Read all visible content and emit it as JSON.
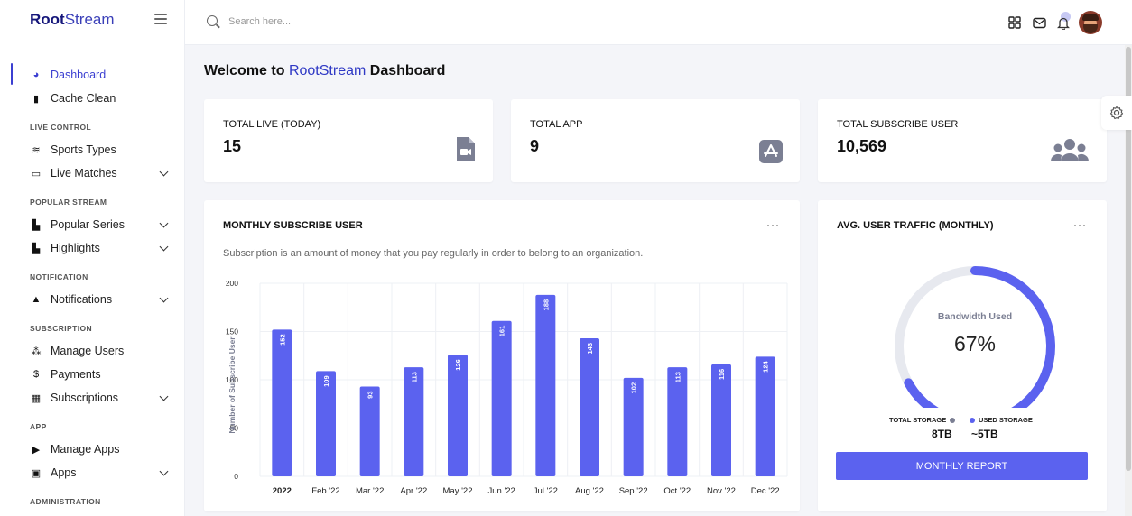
{
  "brand": {
    "strong": "Root",
    "light": "Stream"
  },
  "search": {
    "placeholder": "Search here..."
  },
  "sidebar": {
    "items": [
      {
        "label": "Dashboard",
        "icon": "dashboard-icon",
        "active": true
      },
      {
        "label": "Cache Clean",
        "icon": "trash-icon"
      },
      {
        "section": "LIVE CONTROL"
      },
      {
        "label": "Sports Types",
        "icon": "layers-icon"
      },
      {
        "label": "Live Matches",
        "icon": "monitor-icon",
        "chevron": true
      },
      {
        "section": "POPULAR STREAM"
      },
      {
        "label": "Popular Series",
        "icon": "file-icon",
        "chevron": true
      },
      {
        "label": "Highlights",
        "icon": "file-icon",
        "chevron": true
      },
      {
        "section": "NOTIFICATION"
      },
      {
        "label": "Notifications",
        "icon": "bell-icon",
        "chevron": true
      },
      {
        "section": "SUBSCRIPTION"
      },
      {
        "label": "Manage Users",
        "icon": "users-icon"
      },
      {
        "label": "Payments",
        "icon": "dollar-icon"
      },
      {
        "label": "Subscriptions",
        "icon": "grid-icon",
        "chevron": true
      },
      {
        "section": "APP"
      },
      {
        "label": "Manage Apps",
        "icon": "play-icon"
      },
      {
        "label": "Apps",
        "icon": "image-icon",
        "chevron": true
      },
      {
        "section": "ADMINISTRATION"
      }
    ]
  },
  "welcome": {
    "prefix": "Welcome to ",
    "brand": "RootStream",
    "suffix": " Dashboard"
  },
  "stats": [
    {
      "label": "TOTAL LIVE (TODAY)",
      "value": "15",
      "icon": "video-file-icon"
    },
    {
      "label": "TOTAL APP",
      "value": "9",
      "icon": "app-store-icon"
    },
    {
      "label": "TOTAL SUBSCRIBE USER",
      "value": "10,569",
      "icon": "users-group-icon"
    }
  ],
  "monthly": {
    "title": "MONTHLY SUBSCRIBE USER",
    "dots": "···",
    "description": "Subscription is an amount of money that you pay regularly in order to belong to an organization."
  },
  "traffic": {
    "title": "AVG. USER TRAFFIC (MONTHLY)",
    "dots": "···",
    "gauge_label": "Bandwidth Used",
    "gauge_text": "67%",
    "gauge_value": 0.67,
    "legend": [
      {
        "label": "TOTAL STORAGE",
        "value": "8TB",
        "color": "#7b7f93"
      },
      {
        "label": "USED STORAGE",
        "value": "~5TB",
        "color": "#5b62ef"
      }
    ],
    "button": "MONTHLY REPORT"
  },
  "colors": {
    "accent": "#5b62ef",
    "brand": "#2f39c5",
    "track": "#e7e9ef"
  },
  "chart_data": {
    "type": "bar",
    "categories": [
      "2022",
      "Feb '22",
      "Mar '22",
      "Apr '22",
      "May '22",
      "Jun '22",
      "Jul '22",
      "Aug '22",
      "Sep '22",
      "Oct '22",
      "Nov '22",
      "Dec '22"
    ],
    "values": [
      152,
      109,
      93,
      113,
      126,
      161,
      188,
      143,
      102,
      113,
      116,
      124
    ],
    "ylabel": "Number of Subscribe User",
    "ylim": [
      0,
      200
    ],
    "yticks": [
      0,
      50,
      100,
      150,
      200
    ],
    "grid": true,
    "bar_color": "#5b62ef"
  }
}
